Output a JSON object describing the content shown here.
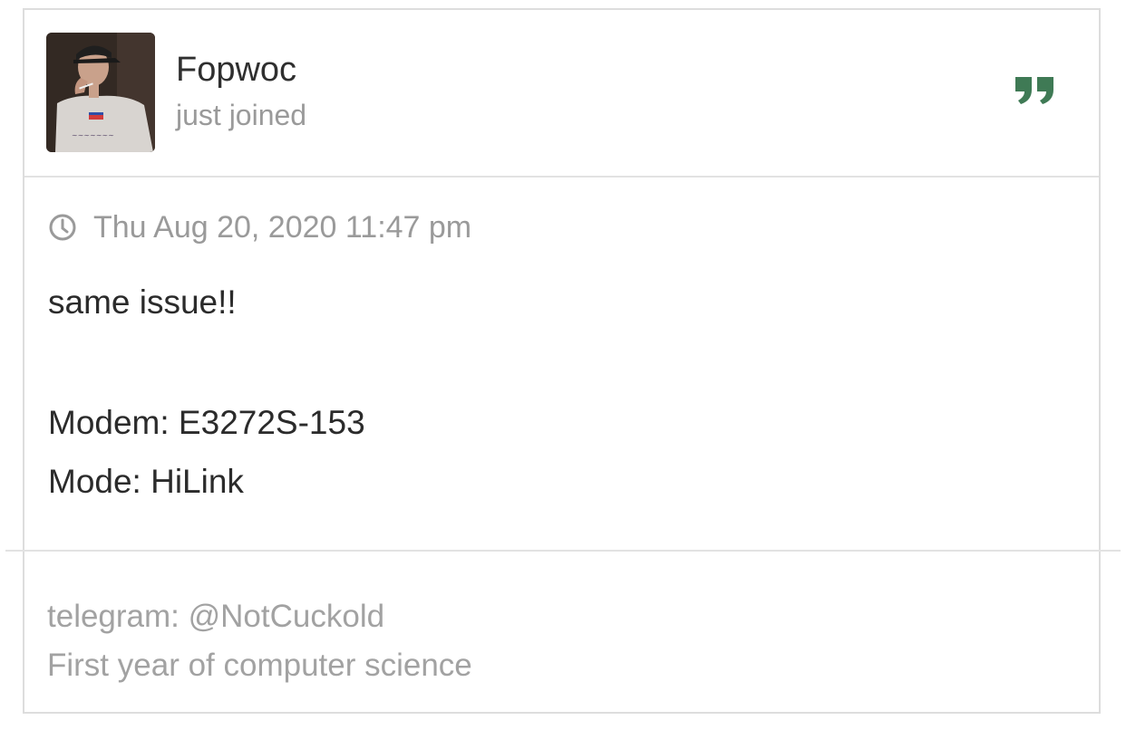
{
  "author": {
    "username": "Fopwoc",
    "rank": "just joined",
    "avatar_icon": "user-photo-avatar"
  },
  "post": {
    "quote_icon": "quote-icon",
    "accent_color": "#3f7a55",
    "timestamp_icon": "clock-icon",
    "timestamp": "Thu Aug 20, 2020 11:47 pm",
    "lines": [
      "same issue!!",
      "Modem: E3272S-153",
      "Mode: HiLink"
    ]
  },
  "signature": {
    "lines": [
      "telegram: @NotCuckold",
      "First year of computer science"
    ]
  }
}
